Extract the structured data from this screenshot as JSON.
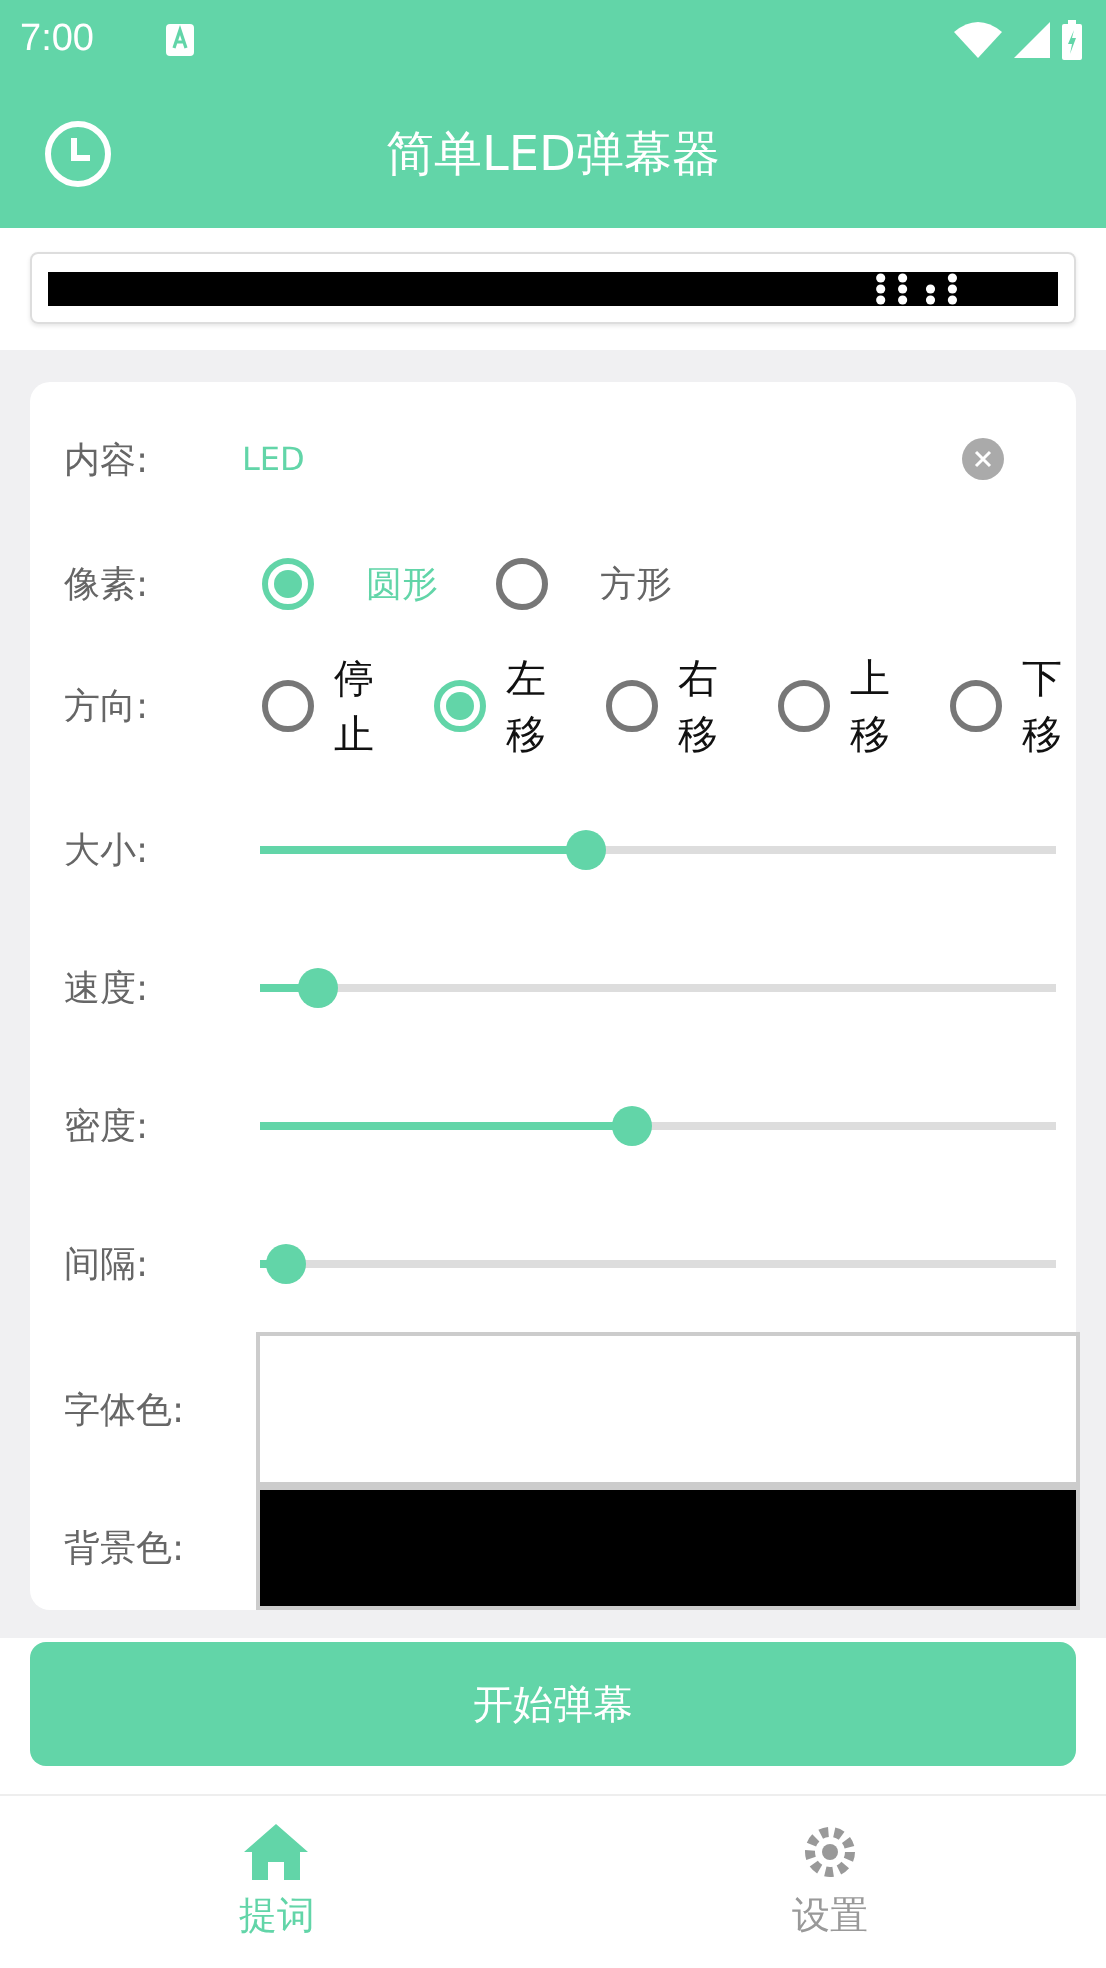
{
  "status_bar": {
    "time": "7:00"
  },
  "app_bar": {
    "title": "简单LED弹幕器"
  },
  "form": {
    "content": {
      "label": "内容:",
      "value": "LED"
    },
    "pixel": {
      "label": "像素:",
      "options": [
        {
          "label": "圆形",
          "selected": true
        },
        {
          "label": "方形",
          "selected": false
        }
      ]
    },
    "direction": {
      "label": "方向:",
      "options": [
        {
          "label": "停止",
          "selected": false
        },
        {
          "label": "左移",
          "selected": true
        },
        {
          "label": "右移",
          "selected": false
        },
        {
          "label": "上移",
          "selected": false
        },
        {
          "label": "下移",
          "selected": false
        }
      ]
    },
    "sliders": [
      {
        "label": "大小:",
        "level": 0.39
      },
      {
        "label": "速度:",
        "level": 0.07
      },
      {
        "label": "密度:",
        "level": 0.445
      },
      {
        "label": "间隔:",
        "level": 0.03
      }
    ],
    "colors": [
      {
        "label": "字体色:",
        "color": "#ffffff"
      },
      {
        "label": "背景色:",
        "color": "#000000"
      }
    ]
  },
  "start_button": "开始弹幕",
  "bottom_nav": [
    {
      "label": "提词",
      "kind": "home",
      "selected": true
    },
    {
      "label": "设置",
      "kind": "settings",
      "selected": false
    }
  ]
}
